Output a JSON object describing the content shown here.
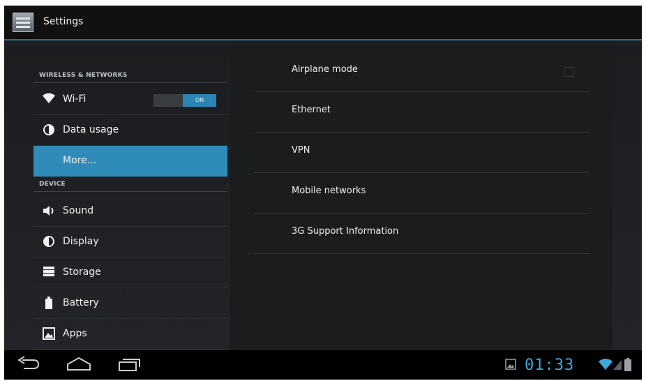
{
  "action_bar": {
    "title": "Settings",
    "icon": "settings-app-icon"
  },
  "left_pane": {
    "categories": [
      {
        "label": "WIRELESS & NETWORKS"
      },
      {
        "label": "DEVICE"
      }
    ],
    "items": [
      {
        "label": "Wi-Fi",
        "icon": "wifi-icon",
        "toggle": "ON"
      },
      {
        "label": "Data usage",
        "icon": "data-usage-icon"
      },
      {
        "label": "More...",
        "selected": true
      },
      {
        "label": "Sound",
        "icon": "sound-icon"
      },
      {
        "label": "Display",
        "icon": "display-icon"
      },
      {
        "label": "Storage",
        "icon": "storage-icon"
      },
      {
        "label": "Battery",
        "icon": "battery-icon"
      },
      {
        "label": "Apps",
        "icon": "apps-icon"
      }
    ]
  },
  "right_pane": {
    "items": [
      {
        "label": "Airplane mode",
        "checkbox": false
      },
      {
        "label": "Ethernet"
      },
      {
        "label": "VPN"
      },
      {
        "label": "Mobile networks"
      },
      {
        "label": "3G Support Information"
      }
    ]
  },
  "nav_bar": {
    "buttons": [
      "back-icon",
      "home-icon",
      "recent-apps-icon"
    ],
    "clock": "01:33",
    "status_icons": [
      "gallery-notification-icon",
      "wifi-signal-icon",
      "cell-signal-icon",
      "battery-status-icon"
    ]
  },
  "colors": {
    "accent": "#2f8bb8",
    "clock": "#3aa9df"
  }
}
